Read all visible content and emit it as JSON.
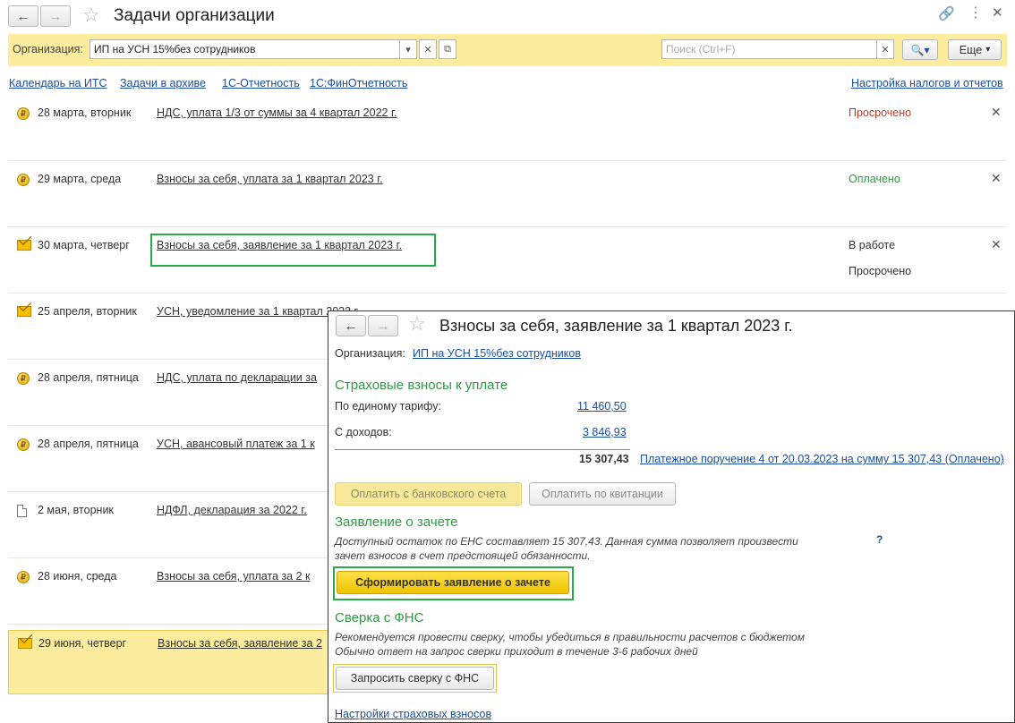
{
  "window": {
    "title": "Задачи организации"
  },
  "toolbar": {
    "org_label": "Организация:",
    "org_value": "ИП на УСН 15%без сотрудников",
    "search_placeholder": "Поиск (Ctrl+F)",
    "more_label": "Еще"
  },
  "links": {
    "calendar": "Календарь на ИТС",
    "archive": "Задачи в архиве",
    "reporting": "1С-Отчетность",
    "fin_reporting": "1С:ФинОтчетность",
    "tax_settings": "Настройка налогов и отчетов"
  },
  "tasks": [
    {
      "icon": "coin-icon",
      "date": "28 марта, вторник",
      "title": "НДС, уплата 1/3 от суммы за 4 квартал 2022 г.",
      "status": "Просрочено",
      "status_color": "#c0392b"
    },
    {
      "icon": "coin-icon",
      "date": "29 марта, среда",
      "title": "Взносы за себя, уплата за 1 квартал 2023 г.",
      "status": "Оплачено",
      "status_color": "#2f9a44"
    },
    {
      "icon": "envelope-icon",
      "date": "30 марта, четверг",
      "title": "Взносы за себя, заявление за 1 квартал 2023 г.",
      "status": "В работе",
      "status2": "Просрочено"
    },
    {
      "icon": "envelope-icon",
      "date": "25 апреля, вторник",
      "title": "УСН, уведомление за 1 квартал 2023 г."
    },
    {
      "icon": "coin-icon",
      "date": "28 апреля, пятница",
      "title": "НДС, уплата по декларации за"
    },
    {
      "icon": "coin-icon",
      "date": "28 апреля, пятница",
      "title": "УСН, авансовый платеж за 1 к"
    },
    {
      "icon": "document-icon",
      "date": "2 мая, вторник",
      "title": "НДФЛ, декларация за 2022 г."
    },
    {
      "icon": "coin-icon",
      "date": "28 июня, среда",
      "title": "Взносы за себя, уплата за 2 к"
    },
    {
      "icon": "envelope-icon",
      "date": "29 июня, четверг",
      "title": "Взносы за себя, заявление за 2"
    }
  ],
  "popup": {
    "title": "Взносы за себя, заявление за 1 квартал 2023 г.",
    "org_label": "Организация:",
    "org_value": "ИП на УСН 15%без сотрудников",
    "contrib_heading": "Страховые взносы к уплате",
    "tariff_label": "По единому тарифу:",
    "tariff_value": "11 460,50",
    "income_label": "С доходов:",
    "income_value": "3 846,93",
    "total": "15 307,43",
    "payment_link": "Платежное поручение 4 от 20.03.2023 на сумму 15 307,43 (Оплачено)",
    "pay_bank_button": "Оплатить с банковского счета",
    "pay_receipt_button": "Оплатить по квитанции",
    "offset_heading": "Заявление о зачете",
    "offset_text_1": "Доступный остаток по ЕНС составляет 15 307,43. Данная сумма позволяет произвести",
    "offset_text_2": "зачет взносов в счет предстоящей обязанности.",
    "help": "?",
    "offset_button": "Сформировать заявление о зачете",
    "recon_heading": "Сверка с ФНС",
    "recon_text_1": "Рекомендуется провести сверку, чтобы убедиться в правильности расчетов с бюджетом",
    "recon_text_2": "Обычно ответ на запрос сверки приходит в течение 3-6 рабочих дней",
    "recon_button": "Запросить сверку с ФНС",
    "settings_link": "Настройки страховых взносов"
  }
}
